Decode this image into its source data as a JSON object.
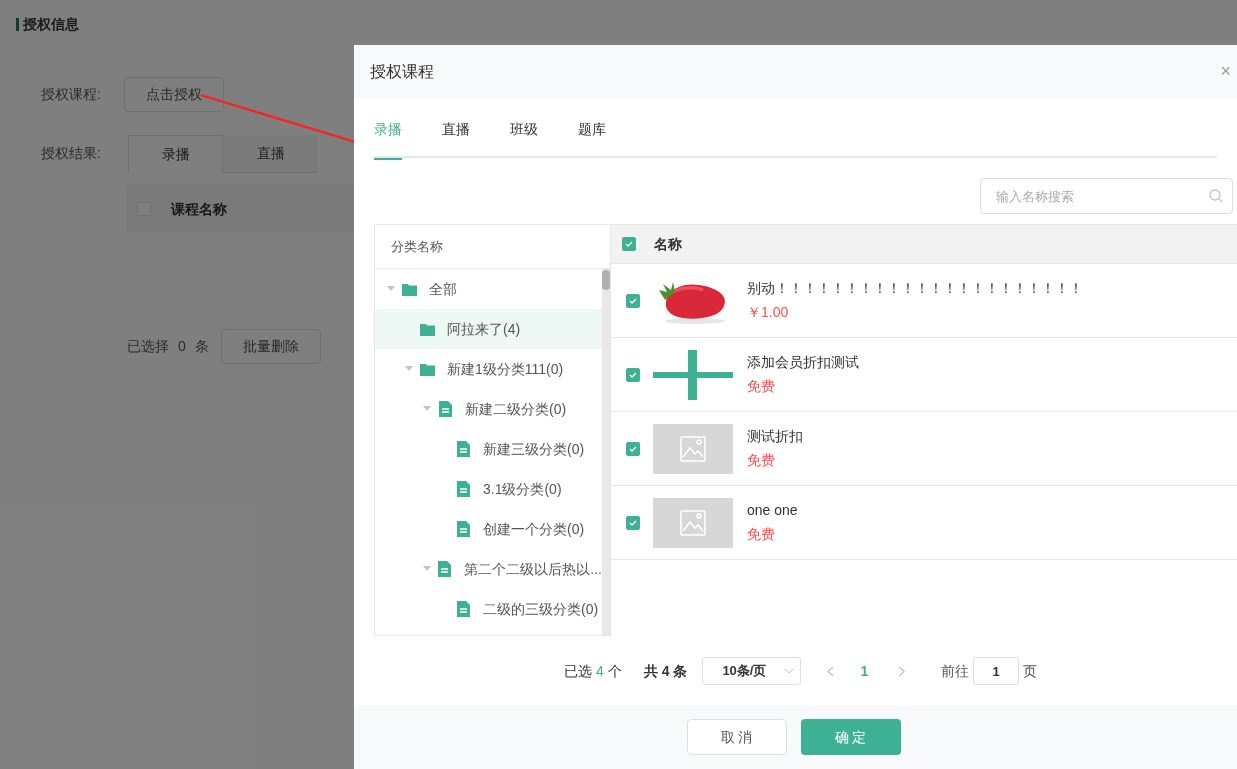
{
  "page": {
    "title": "授权信息",
    "course_label": "授权课程:",
    "authorize_button": "点击授权",
    "result_label": "授权结果:",
    "result_tabs": [
      {
        "label": "录播",
        "selected": true
      },
      {
        "label": "直播",
        "selected": false
      }
    ],
    "table": {
      "checked": false,
      "column": "课程名称"
    },
    "selection": {
      "prefix": "已选择",
      "count": "0",
      "suffix": "条"
    },
    "batch_delete": "批量删除"
  },
  "dialog": {
    "title": "授权课程",
    "close": "×",
    "tabs": [
      {
        "label": "录播",
        "selected": true
      },
      {
        "label": "直播",
        "selected": false
      },
      {
        "label": "班级",
        "selected": false
      },
      {
        "label": "题库",
        "selected": false
      }
    ],
    "search": {
      "placeholder": "输入名称搜索"
    },
    "tree": {
      "header": "分类名称",
      "items": [
        {
          "label": "全部",
          "kind": "folder",
          "expanded": true,
          "selected": false,
          "children": [
            {
              "label": "阿拉来了(4)",
              "kind": "folder",
              "selected": true
            },
            {
              "label": "新建1级分类111(0)",
              "kind": "folder",
              "expanded": true,
              "selected": false,
              "children": [
                {
                  "label": "新建二级分类(0)",
                  "kind": "file",
                  "expanded": true,
                  "selected": false,
                  "children": [
                    {
                      "label": "新建三级分类(0)",
                      "kind": "file",
                      "selected": false
                    },
                    {
                      "label": "3.1级分类(0)",
                      "kind": "file",
                      "selected": false
                    },
                    {
                      "label": "创建一个分类(0)",
                      "kind": "file",
                      "selected": false
                    }
                  ]
                },
                {
                  "label": "第二个二级以后热以...",
                  "kind": "file",
                  "expanded": true,
                  "selected": false,
                  "children": [
                    {
                      "label": "二级的三级分类(0)",
                      "kind": "file",
                      "selected": false
                    }
                  ]
                }
              ]
            }
          ]
        }
      ]
    },
    "table": {
      "all_checked": true,
      "column": "名称",
      "rows": [
        {
          "checked": true,
          "name": "别动！！！！！！！！！！！！！！！！！！！！！！",
          "price": "￥1.00"
        },
        {
          "checked": true,
          "name": "添加会员折扣测试",
          "price": "免费"
        },
        {
          "checked": true,
          "thumbnail": {
            "kind": "placeholder"
          },
          "name": "测试折扣",
          "price": "免费"
        },
        {
          "checked": true,
          "thumbnail": {
            "kind": "placeholder"
          },
          "name": "one one",
          "price": "免费"
        }
      ]
    },
    "pagination": {
      "selected_prefix": "已选",
      "selected_count": "4",
      "selected_suffix": "个",
      "total": "共 4 条",
      "page_size": "10条/页",
      "pages": [
        {
          "label": "1",
          "selected": true
        }
      ],
      "goto_label": "前往",
      "goto_value": "1",
      "goto_suffix": "页"
    },
    "buttons": {
      "cancel": "取 消",
      "confirm": "确 定"
    }
  }
}
